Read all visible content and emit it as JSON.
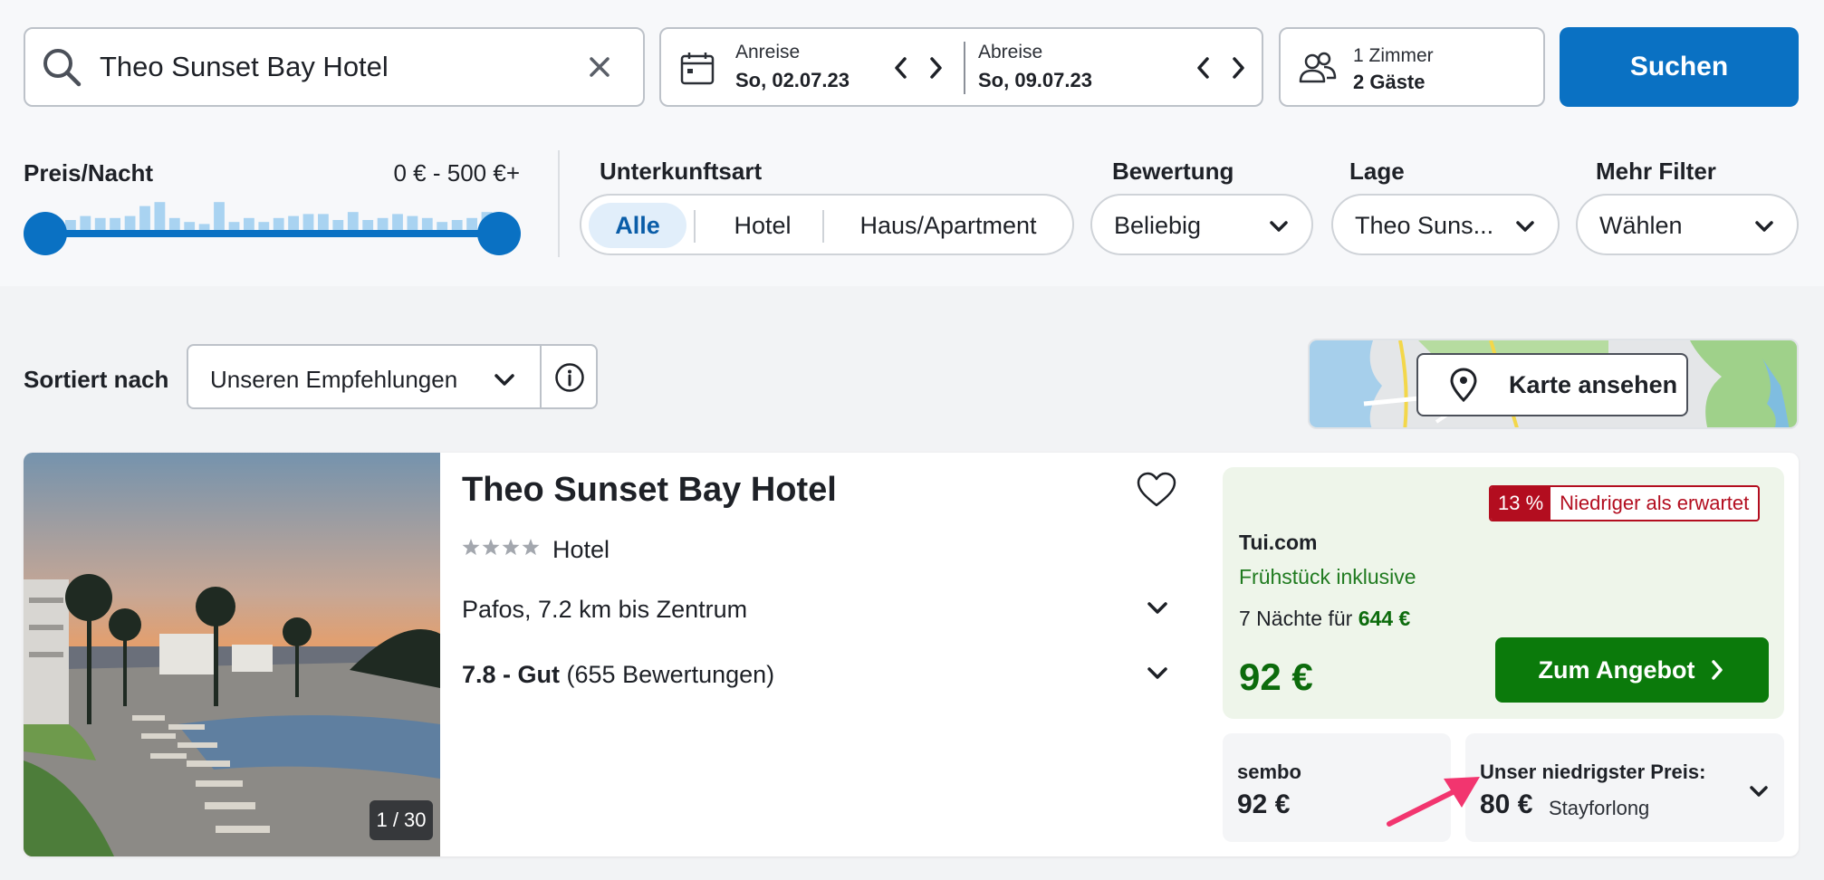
{
  "search": {
    "query": "Theo Sunset Bay Hotel"
  },
  "dates": {
    "arrival_label": "Anreise",
    "arrival_value": "So, 02.07.23",
    "departure_label": "Abreise",
    "departure_value": "So, 09.07.23"
  },
  "guests": {
    "rooms": "1 Zimmer",
    "guests": "2 Gäste"
  },
  "search_button": "Suchen",
  "filters": {
    "price_title": "Preis/Nacht",
    "price_range": "0 € - 500 €+",
    "price_histogram": [
      0.25,
      0.35,
      0.3,
      0.3,
      0.35,
      0.6,
      0.7,
      0.3,
      0.2,
      0.15,
      0.7,
      0.2,
      0.3,
      0.2,
      0.3,
      0.35,
      0.4,
      0.4,
      0.25,
      0.45,
      0.25,
      0.3,
      0.4,
      0.35,
      0.3,
      0.2,
      0.25,
      0.3,
      0.45
    ],
    "type_title": "Unterkunftsart",
    "types": [
      "Alle",
      "Hotel",
      "Haus/Apartment"
    ],
    "rating_title": "Bewertung",
    "rating_value": "Beliebig",
    "location_title": "Lage",
    "location_value": "Theo Suns...",
    "more_title": "Mehr Filter",
    "more_value": "Wählen"
  },
  "sort": {
    "label": "Sortiert nach",
    "value": "Unseren Empfehlungen"
  },
  "map": {
    "button": "Karte ansehen"
  },
  "hotel": {
    "name": "Theo Sunset Bay Hotel",
    "stars": 4,
    "type": "Hotel",
    "location": "Pafos, 7.2 km bis Zentrum",
    "rating_score": "7.8 - Gut",
    "rating_count": "(655 Bewertungen)",
    "photo_counter": "1 / 30"
  },
  "offer": {
    "badge_pct": "13 %",
    "badge_text": "Niedriger als erwartet",
    "provider": "Tui.com",
    "breakfast": "Frühstück inklusive",
    "nights_text": "7 Nächte für ",
    "nights_total": "644 €",
    "price": "92 €",
    "button": "Zum Angebot"
  },
  "alternatives": {
    "sembo_provider": "sembo",
    "sembo_price": "92 €",
    "lowest_label": "Unser niedrigster Preis:",
    "lowest_price": "80 €",
    "lowest_source": "Stayforlong"
  },
  "colors": {
    "primary_blue": "#0a71c3",
    "offer_green": "#0b7a0b",
    "alert_red": "#b30d1f",
    "annotation_pink": "#f2356f"
  }
}
